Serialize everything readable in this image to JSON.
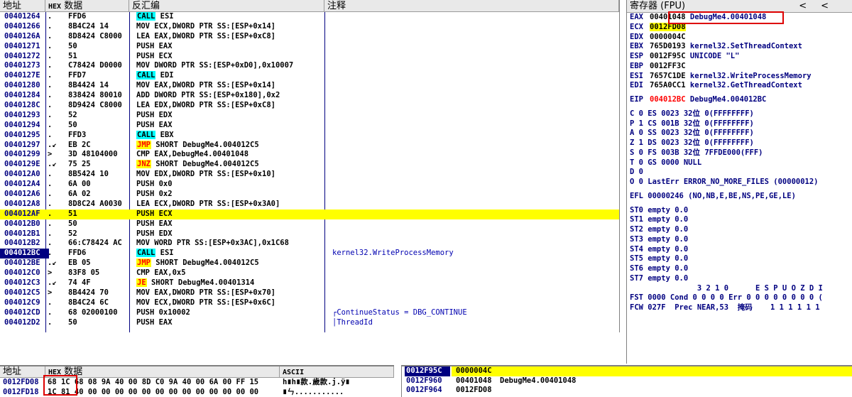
{
  "cpu": {
    "headers": {
      "address": "地址",
      "hex": "HEX",
      "hex_data": "数据",
      "disasm": "反汇编",
      "comment": "注释"
    },
    "rows": [
      {
        "addr": "00401264",
        "mark": ".",
        "hex": "FFD6",
        "pre": "",
        "instr": "CALL",
        "rest": " ESI",
        "type": "call",
        "cmt": ""
      },
      {
        "addr": "00401266",
        "mark": ".",
        "hex": "8B4C24 14",
        "pre": "",
        "instr": "",
        "rest": "MOV ECX,DWORD PTR SS:[ESP+0x14]",
        "type": "",
        "cmt": ""
      },
      {
        "addr": "0040126A",
        "mark": ".",
        "hex": "8D8424 C8000",
        "pre": "",
        "instr": "",
        "rest": "LEA EAX,DWORD PTR SS:[ESP+0xC8]",
        "type": "",
        "cmt": ""
      },
      {
        "addr": "00401271",
        "mark": ".",
        "hex": "50",
        "pre": "",
        "instr": "",
        "rest": "PUSH EAX",
        "type": "",
        "cmt": ""
      },
      {
        "addr": "00401272",
        "mark": ".",
        "hex": "51",
        "pre": "",
        "instr": "",
        "rest": "PUSH ECX",
        "type": "",
        "cmt": ""
      },
      {
        "addr": "00401273",
        "mark": ".",
        "hex": "C78424 D0000",
        "pre": "",
        "instr": "",
        "rest": "MOV DWORD PTR SS:[ESP+0xD0],0x10007",
        "type": "",
        "cmt": ""
      },
      {
        "addr": "0040127E",
        "mark": ".",
        "hex": "FFD7",
        "pre": "",
        "instr": "CALL",
        "rest": " EDI",
        "type": "call",
        "cmt": ""
      },
      {
        "addr": "00401280",
        "mark": ".",
        "hex": "8B4424 14",
        "pre": "",
        "instr": "",
        "rest": "MOV EAX,DWORD PTR SS:[ESP+0x14]",
        "type": "",
        "cmt": ""
      },
      {
        "addr": "00401284",
        "mark": ".",
        "hex": "838424 80010",
        "pre": "",
        "instr": "",
        "rest": "ADD DWORD PTR SS:[ESP+0x180],0x2",
        "type": "",
        "cmt": ""
      },
      {
        "addr": "0040128C",
        "mark": ".",
        "hex": "8D9424 C8000",
        "pre": "",
        "instr": "",
        "rest": "LEA EDX,DWORD PTR SS:[ESP+0xC8]",
        "type": "",
        "cmt": ""
      },
      {
        "addr": "00401293",
        "mark": ".",
        "hex": "52",
        "pre": "",
        "instr": "",
        "rest": "PUSH EDX",
        "type": "",
        "cmt": ""
      },
      {
        "addr": "00401294",
        "mark": ".",
        "hex": "50",
        "pre": "",
        "instr": "",
        "rest": "PUSH EAX",
        "type": "",
        "cmt": ""
      },
      {
        "addr": "00401295",
        "mark": ".",
        "hex": "FFD3",
        "pre": "",
        "instr": "CALL",
        "rest": " EBX",
        "type": "call",
        "cmt": ""
      },
      {
        "addr": "00401297",
        "mark": ".↙",
        "hex": "EB 2C",
        "pre": "",
        "instr": "JMP",
        "rest": " SHORT DebugMe4.004012C5",
        "type": "jmp",
        "cmt": ""
      },
      {
        "addr": "00401299",
        "mark": ">",
        "hex": "3D 48104000",
        "pre": "",
        "instr": "",
        "rest": "CMP EAX,DebugMe4.00401048",
        "type": "",
        "cmt": ""
      },
      {
        "addr": "0040129E",
        "mark": ".↙",
        "hex": "75 25",
        "pre": "",
        "instr": "JNZ",
        "rest": " SHORT DebugMe4.004012C5",
        "type": "jmp",
        "cmt": ""
      },
      {
        "addr": "004012A0",
        "mark": ".",
        "hex": "8B5424 10",
        "pre": "",
        "instr": "",
        "rest": "MOV EDX,DWORD PTR SS:[ESP+0x10]",
        "type": "",
        "cmt": ""
      },
      {
        "addr": "004012A4",
        "mark": ".",
        "hex": "6A 00",
        "pre": "",
        "instr": "",
        "rest": "PUSH 0x0",
        "type": "",
        "cmt": ""
      },
      {
        "addr": "004012A6",
        "mark": ".",
        "hex": "6A 02",
        "pre": "",
        "instr": "",
        "rest": "PUSH 0x2",
        "type": "",
        "cmt": ""
      },
      {
        "addr": "004012A8",
        "mark": ".",
        "hex": "8D8C24 A0030",
        "pre": "",
        "instr": "",
        "rest": "LEA ECX,DWORD PTR SS:[ESP+0x3A0]",
        "type": "",
        "cmt": ""
      },
      {
        "addr": "004012AF",
        "mark": ".",
        "hex": "51",
        "pre": "",
        "instr": "",
        "rest": "PUSH ECX",
        "type": "",
        "cmt": "",
        "hl": true,
        "cur": true
      },
      {
        "addr": "004012B0",
        "mark": ".",
        "hex": "50",
        "pre": "",
        "instr": "",
        "rest": "PUSH EAX",
        "type": "",
        "cmt": ""
      },
      {
        "addr": "004012B1",
        "mark": ".",
        "hex": "52",
        "pre": "",
        "instr": "",
        "rest": "PUSH EDX",
        "type": "",
        "cmt": ""
      },
      {
        "addr": "004012B2",
        "mark": ".",
        "hex": "66:C78424 AC",
        "pre": "",
        "instr": "",
        "rest": "MOV WORD PTR SS:[ESP+0x3AC],0x1C68",
        "type": "",
        "cmt": ""
      },
      {
        "addr": "004012BC",
        "mark": ".",
        "hex": "FFD6",
        "pre": "",
        "instr": "CALL",
        "rest": " ESI",
        "type": "call",
        "cmt": "kernel32.WriteProcessMemory",
        "eip": true
      },
      {
        "addr": "004012BE",
        "mark": ".↙",
        "hex": "EB 05",
        "pre": "",
        "instr": "JMP",
        "rest": " SHORT DebugMe4.004012C5",
        "type": "jmp",
        "cmt": ""
      },
      {
        "addr": "004012C0",
        "mark": ">",
        "hex": "83F8 05",
        "pre": "",
        "instr": "",
        "rest": "CMP EAX,0x5",
        "type": "",
        "cmt": ""
      },
      {
        "addr": "004012C3",
        "mark": ".↙",
        "hex": "74 4F",
        "pre": "",
        "instr": "JE",
        "rest": " SHORT DebugMe4.00401314",
        "type": "jmp",
        "cmt": ""
      },
      {
        "addr": "004012C5",
        "mark": ">",
        "hex": "8B4424 70",
        "pre": "",
        "instr": "",
        "rest": "MOV EAX,DWORD PTR SS:[ESP+0x70]",
        "type": "",
        "cmt": ""
      },
      {
        "addr": "004012C9",
        "mark": ".",
        "hex": "8B4C24 6C",
        "pre": "",
        "instr": "",
        "rest": "MOV ECX,DWORD PTR SS:[ESP+0x6C]",
        "type": "",
        "cmt": ""
      },
      {
        "addr": "004012CD",
        "mark": ".",
        "hex": "68 02000100",
        "pre": "",
        "instr": "",
        "rest": "PUSH 0x10002",
        "type": "",
        "cmt": "┌ContinueStatus = DBG_CONTINUE"
      },
      {
        "addr": "004012D2",
        "mark": ".",
        "hex": "50",
        "pre": "",
        "instr": "",
        "rest": "PUSH EAX",
        "type": "",
        "cmt": "│ThreadId"
      }
    ]
  },
  "registers": {
    "title": "寄存器 (FPU)",
    "arrows": [
      "<",
      "<"
    ],
    "gp": [
      {
        "n": "EAX",
        "v": "00401048",
        "c": "DebugMe4.00401048"
      },
      {
        "n": "ECX",
        "v": "0012FD08",
        "c": "",
        "yellow": true
      },
      {
        "n": "EDX",
        "v": "0000004C",
        "c": ""
      },
      {
        "n": "EBX",
        "v": "765D0193",
        "c": "kernel32.SetThreadContext"
      },
      {
        "n": "ESP",
        "v": "0012F95C",
        "c": "UNICODE \"L\""
      },
      {
        "n": "EBP",
        "v": "0012FF3C",
        "c": ""
      },
      {
        "n": "ESI",
        "v": "7657C1DE",
        "c": "kernel32.WriteProcessMemory"
      },
      {
        "n": "EDI",
        "v": "765A0CC1",
        "c": "kernel32.GetThreadContext"
      }
    ],
    "eip": {
      "n": "EIP",
      "v": "004012BC",
      "c": "DebugMe4.004012BC"
    },
    "flags": [
      "C 0  ES 0023 32位 0(FFFFFFFF)",
      "P 1  CS 001B 32位 0(FFFFFFFF)",
      "A 0  SS 0023 32位 0(FFFFFFFF)",
      "Z 1  DS 0023 32位 0(FFFFFFFF)",
      "S 0  FS 003B 32位 7FFDE000(FFF)",
      "T 0  GS 0000 NULL",
      "D 0",
      "O 0  LastErr ERROR_NO_MORE_FILES (00000012)"
    ],
    "efl": "EFL 00000246 (NO,NB,E,BE,NS,PE,GE,LE)",
    "st": [
      "ST0 empty 0.0",
      "ST1 empty 0.0",
      "ST2 empty 0.0",
      "ST3 empty 0.0",
      "ST4 empty 0.0",
      "ST5 empty 0.0",
      "ST6 empty 0.0",
      "ST7 empty 0.0"
    ],
    "fpu_hdr": "               3 2 1 0      E S P U O Z D I",
    "fst": "FST 0000  Cond 0 0 0 0  Err 0 0 0 0 0 0 0 0  (",
    "fcw": "FCW 027F  Prec NEAR,53  掩码    1 1 1 1 1 1"
  },
  "dump": {
    "headers": {
      "address": "地址",
      "hex": "HEX",
      "hex_data": "数据",
      "ascii": "ASCII"
    },
    "rows": [
      {
        "addr": "0012FD08",
        "hex": "68 1C 68 08 9A 40 00 8D C0 9A 40 00 6A 00 FF 15",
        "ascii": "h∎h∎款.歲款.j.ÿ∎"
      },
      {
        "addr": "0012FD18",
        "hex": "1C 81 40 00 00 00 00 00 00 00 00 00 00 00 00 00",
        "ascii": "∎ㄣ..........."
      }
    ]
  },
  "stack": {
    "rows": [
      {
        "addr": "0012F95C",
        "val": "0000004C",
        "cmt": "",
        "cur": true
      },
      {
        "addr": "0012F960",
        "val": "00401048",
        "cmt": "DebugMe4.00401048"
      },
      {
        "addr": "0012F964",
        "val": "0012FD08",
        "cmt": ""
      }
    ]
  },
  "colors": {
    "highlight": "#ffff00",
    "call": "#00ffff",
    "jump_text": "#ff0000",
    "address": "#000080",
    "annotation": "#dd0000"
  }
}
